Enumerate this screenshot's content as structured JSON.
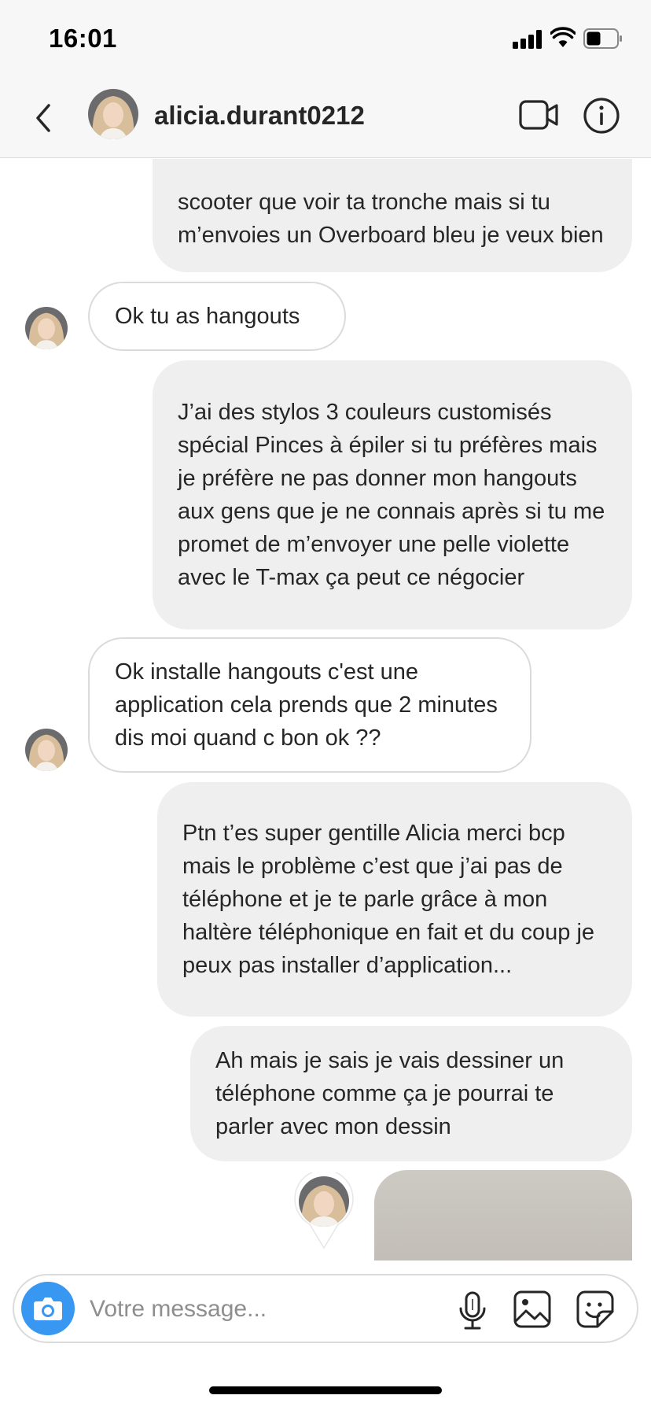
{
  "status_bar": {
    "time": "16:01"
  },
  "header": {
    "username": "alicia.durant0212",
    "back_icon": "chevron-left-icon",
    "video_icon": "video-camera-icon",
    "info_icon": "info-circle-icon"
  },
  "messages": [
    {
      "sender": "me",
      "text": "scooter que voir ta tronche mais si tu m’envoies un Overboard bleu je veux bien"
    },
    {
      "sender": "alicia",
      "text": "Ok tu as hangouts"
    },
    {
      "sender": "me",
      "text": "J’ai des stylos 3 couleurs customisés spécial Pinces à épiler si tu préfères mais je préfère ne pas donner mon hangouts aux gens que je ne connais après si tu me promet de m’envoyer une pelle violette avec le T-max ça peut ce négocier"
    },
    {
      "sender": "alicia",
      "text": "Ok installe hangouts c'est une application cela prends que 2 minutes dis moi quand c bon ok ??"
    },
    {
      "sender": "me",
      "text": "Ptn t’es super gentille Alicia merci bcp mais le problème c’est que j’ai pas de téléphone et je te parle grâce à mon haltère téléphonique en fait et du coup je peux pas installer d’application..."
    },
    {
      "sender": "me",
      "text": "Ah mais je sais je vais dessiner un téléphone comme ça je pourrai te parler avec mon dessin"
    },
    {
      "sender": "me",
      "type": "image"
    }
  ],
  "composer": {
    "placeholder": "Votre message...",
    "camera_icon": "camera-icon",
    "mic_icon": "microphone-icon",
    "gallery_icon": "gallery-icon",
    "sticker_icon": "sticker-icon"
  },
  "colors": {
    "accent": "#3897f0",
    "bubble_out": "#efefef",
    "bubble_in_border": "#dbdbdb",
    "text": "#262626",
    "placeholder": "#8e8e8e"
  }
}
